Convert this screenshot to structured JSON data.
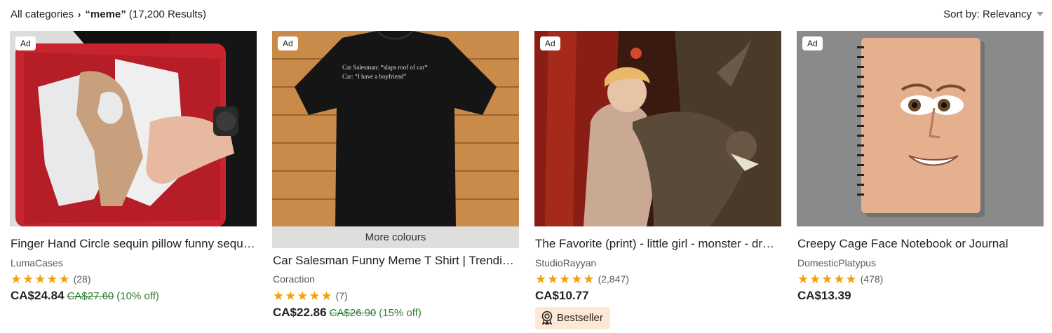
{
  "breadcrumb": {
    "category": "All categories",
    "query": "“meme”",
    "results": "(17,200 Results)"
  },
  "sort": {
    "label": "Sort by: Relevancy"
  },
  "listings": [
    {
      "ad": "Ad",
      "title": "Finger Hand Circle sequin pillow funny sequin pillow fun gift",
      "shop": "LumaCases",
      "stars": "★★★★★",
      "reviews": "(28)",
      "rating": 4.5,
      "price": "CA$24.84",
      "original": "CA$27.60",
      "discount": "(10% off)"
    },
    {
      "ad": "Ad",
      "more_colours": "More colours",
      "shirt_text_1": "Car Salesman: *slaps roof of car*",
      "shirt_text_2": "Car: “I have a boyfriend”",
      "title": "Car Salesman Funny Meme T Shirt | Trending Meme Shirt",
      "shop": "Coraction",
      "stars": "★★★★★",
      "reviews": "(7)",
      "rating": 5,
      "price": "CA$22.86",
      "original": "CA$26.90",
      "discount": "(15% off)"
    },
    {
      "ad": "Ad",
      "title": "The Favorite (print) - little girl - monster - dragon - art",
      "shop": "StudioRayyan",
      "stars": "★★★★★",
      "reviews": "(2,847)",
      "rating": 5,
      "price": "CA$10.77",
      "badge": "Bestseller"
    },
    {
      "ad": "Ad",
      "title": "Creepy Cage Face Notebook or Journal",
      "shop": "DomesticPlatypus",
      "stars": "★★★★★",
      "reviews": "(478)",
      "rating": 5,
      "price": "CA$13.39"
    }
  ],
  "colors": {
    "star": "#f1a10d",
    "discount": "#2e7d32",
    "badge_bg": "#fde8d6",
    "more_colours_bg": "#dedede"
  }
}
